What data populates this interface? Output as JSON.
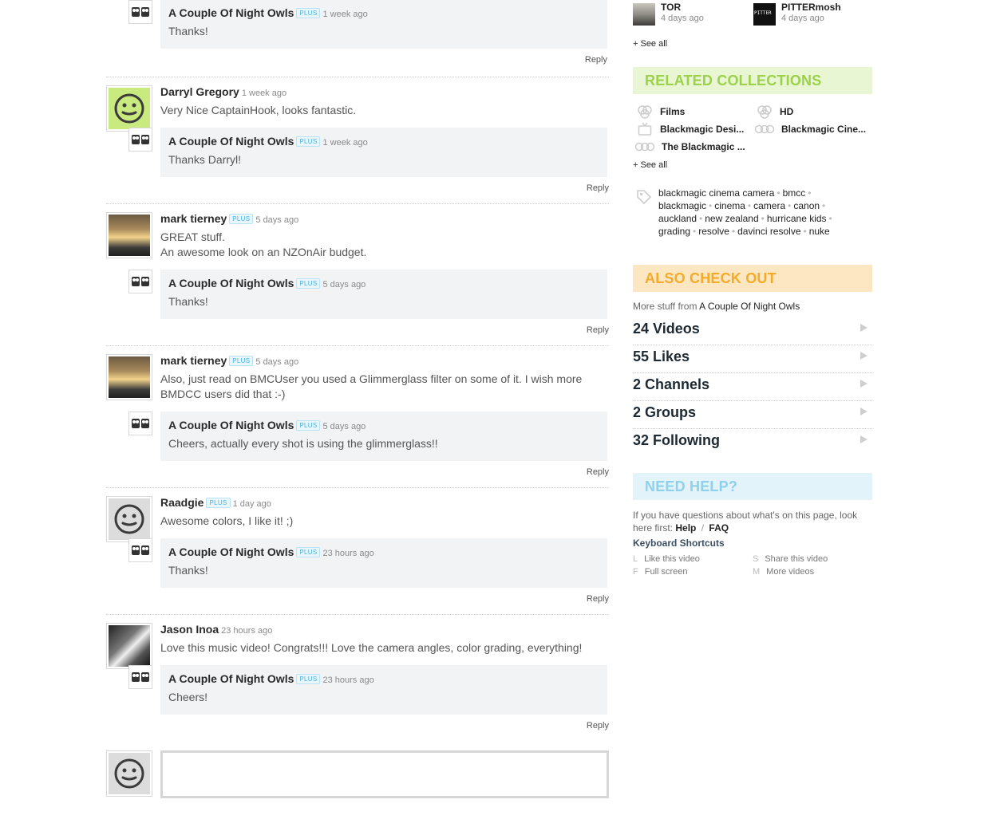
{
  "threads": [
    {
      "partial": true,
      "reply": {
        "author": "A Couple Of Night Owls",
        "plus": "PLUS",
        "time": "1 week ago",
        "text": "Thanks!"
      },
      "reply_link": "Reply"
    },
    {
      "author": "Darryl Gregory",
      "plus": "",
      "time": "1 week ago",
      "text": "Very Nice CaptainHook, looks fantastic.",
      "reply": {
        "author": "A Couple Of Night Owls",
        "plus": "PLUS",
        "time": "1 week ago",
        "text": "Thanks Darryl!"
      },
      "reply_link": "Reply"
    },
    {
      "author": "mark tierney",
      "plus": "PLUS",
      "time": "5 days ago",
      "text": "GREAT stuff.",
      "text2": "An awesome look on an NZOnAir budget.",
      "reply": {
        "author": "A Couple Of Night Owls",
        "plus": "PLUS",
        "time": "5 days ago",
        "text": "Thanks!"
      },
      "reply_link": "Reply"
    },
    {
      "author": "mark tierney",
      "plus": "PLUS",
      "time": "5 days ago",
      "text": "Also, just read on BMCUser you used a Glimmerglass filter on some of it. I wish more BMDCC users did that :-)",
      "reply": {
        "author": "A Couple Of Night Owls",
        "plus": "PLUS",
        "time": "5 days ago",
        "text": "Cheers, actually every shot is using the glimmerglass!!"
      },
      "reply_link": "Reply"
    },
    {
      "author": "Raadgie",
      "plus": "PLUS",
      "time": "1 day ago",
      "text": "Awesome colors, I like it! ;)",
      "reply": {
        "author": "A Couple Of Night Owls",
        "plus": "PLUS",
        "time": "23 hours ago",
        "text": "Thanks!"
      },
      "reply_link": "Reply"
    },
    {
      "author": "Jason Inoa",
      "plus": "",
      "time": "23 hours ago",
      "text": "Love this music video! Congrats!!! Love the camera angles, color grading, everything!",
      "reply": {
        "author": "A Couple Of Night Owls",
        "plus": "PLUS",
        "time": "23 hours ago",
        "text": "Cheers!"
      },
      "reply_link": "Reply"
    }
  ],
  "sidebar": {
    "users": [
      {
        "name": "TOR",
        "time": "4 days ago"
      },
      {
        "name": "PITTERmosh",
        "time": "4 days ago"
      }
    ],
    "see_all": "+ See all",
    "related_title": "RELATED COLLECTIONS",
    "collections": [
      "Films",
      "HD",
      "Blackmagic Desi...",
      "Blackmagic Cine...",
      "The Blackmagic ..."
    ],
    "tags": [
      "blackmagic cinema camera",
      "bmcc",
      "blackmagic",
      "cinema",
      "camera",
      "canon",
      "auckland",
      "new zealand",
      "hurricane kids",
      "grading",
      "resolve",
      "davinci resolve",
      "nuke"
    ],
    "also_title": "ALSO CHECK OUT",
    "more_from_prefix": "More stuff from",
    "more_from_name": "A Couple Of Night Owls",
    "stats": [
      "24 Videos",
      "55 Likes",
      "2 Channels",
      "2 Groups",
      "32 Following"
    ],
    "help_title": "NEED HELP?",
    "help_text": "If you have questions about what's on this page, look here first:",
    "help_link": "Help",
    "help_sep": "/",
    "faq_link": "FAQ",
    "shortcuts_title": "Keyboard Shortcuts",
    "shortcuts": [
      {
        "key": "L",
        "label": "Like this video"
      },
      {
        "key": "S",
        "label": "Share this video"
      },
      {
        "key": "F",
        "label": "Full screen"
      },
      {
        "key": "M",
        "label": "More videos"
      }
    ]
  },
  "colors": {
    "green_head": "#9cd149",
    "orange_head": "#f5ab2a",
    "blue_head": "#8fd0ec",
    "plus_badge": "#43b3e4"
  }
}
